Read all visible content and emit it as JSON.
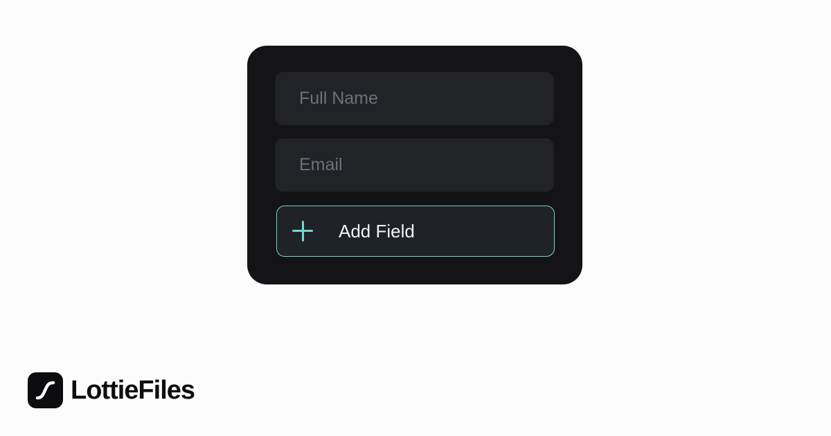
{
  "form": {
    "full_name": {
      "placeholder": "Full Name",
      "value": ""
    },
    "email": {
      "placeholder": "Email",
      "value": ""
    },
    "add_field": {
      "label": "Add Field",
      "icon": "plus-icon",
      "accent_color": "#74d7d0"
    }
  },
  "brand": {
    "logo_icon": "lottiefiles-logo-icon",
    "name": "LottieFiles"
  },
  "colors": {
    "card_background": "#141417",
    "field_background": "#222327",
    "accent": "#74d7d0",
    "page_background": "#fcfcfd"
  }
}
